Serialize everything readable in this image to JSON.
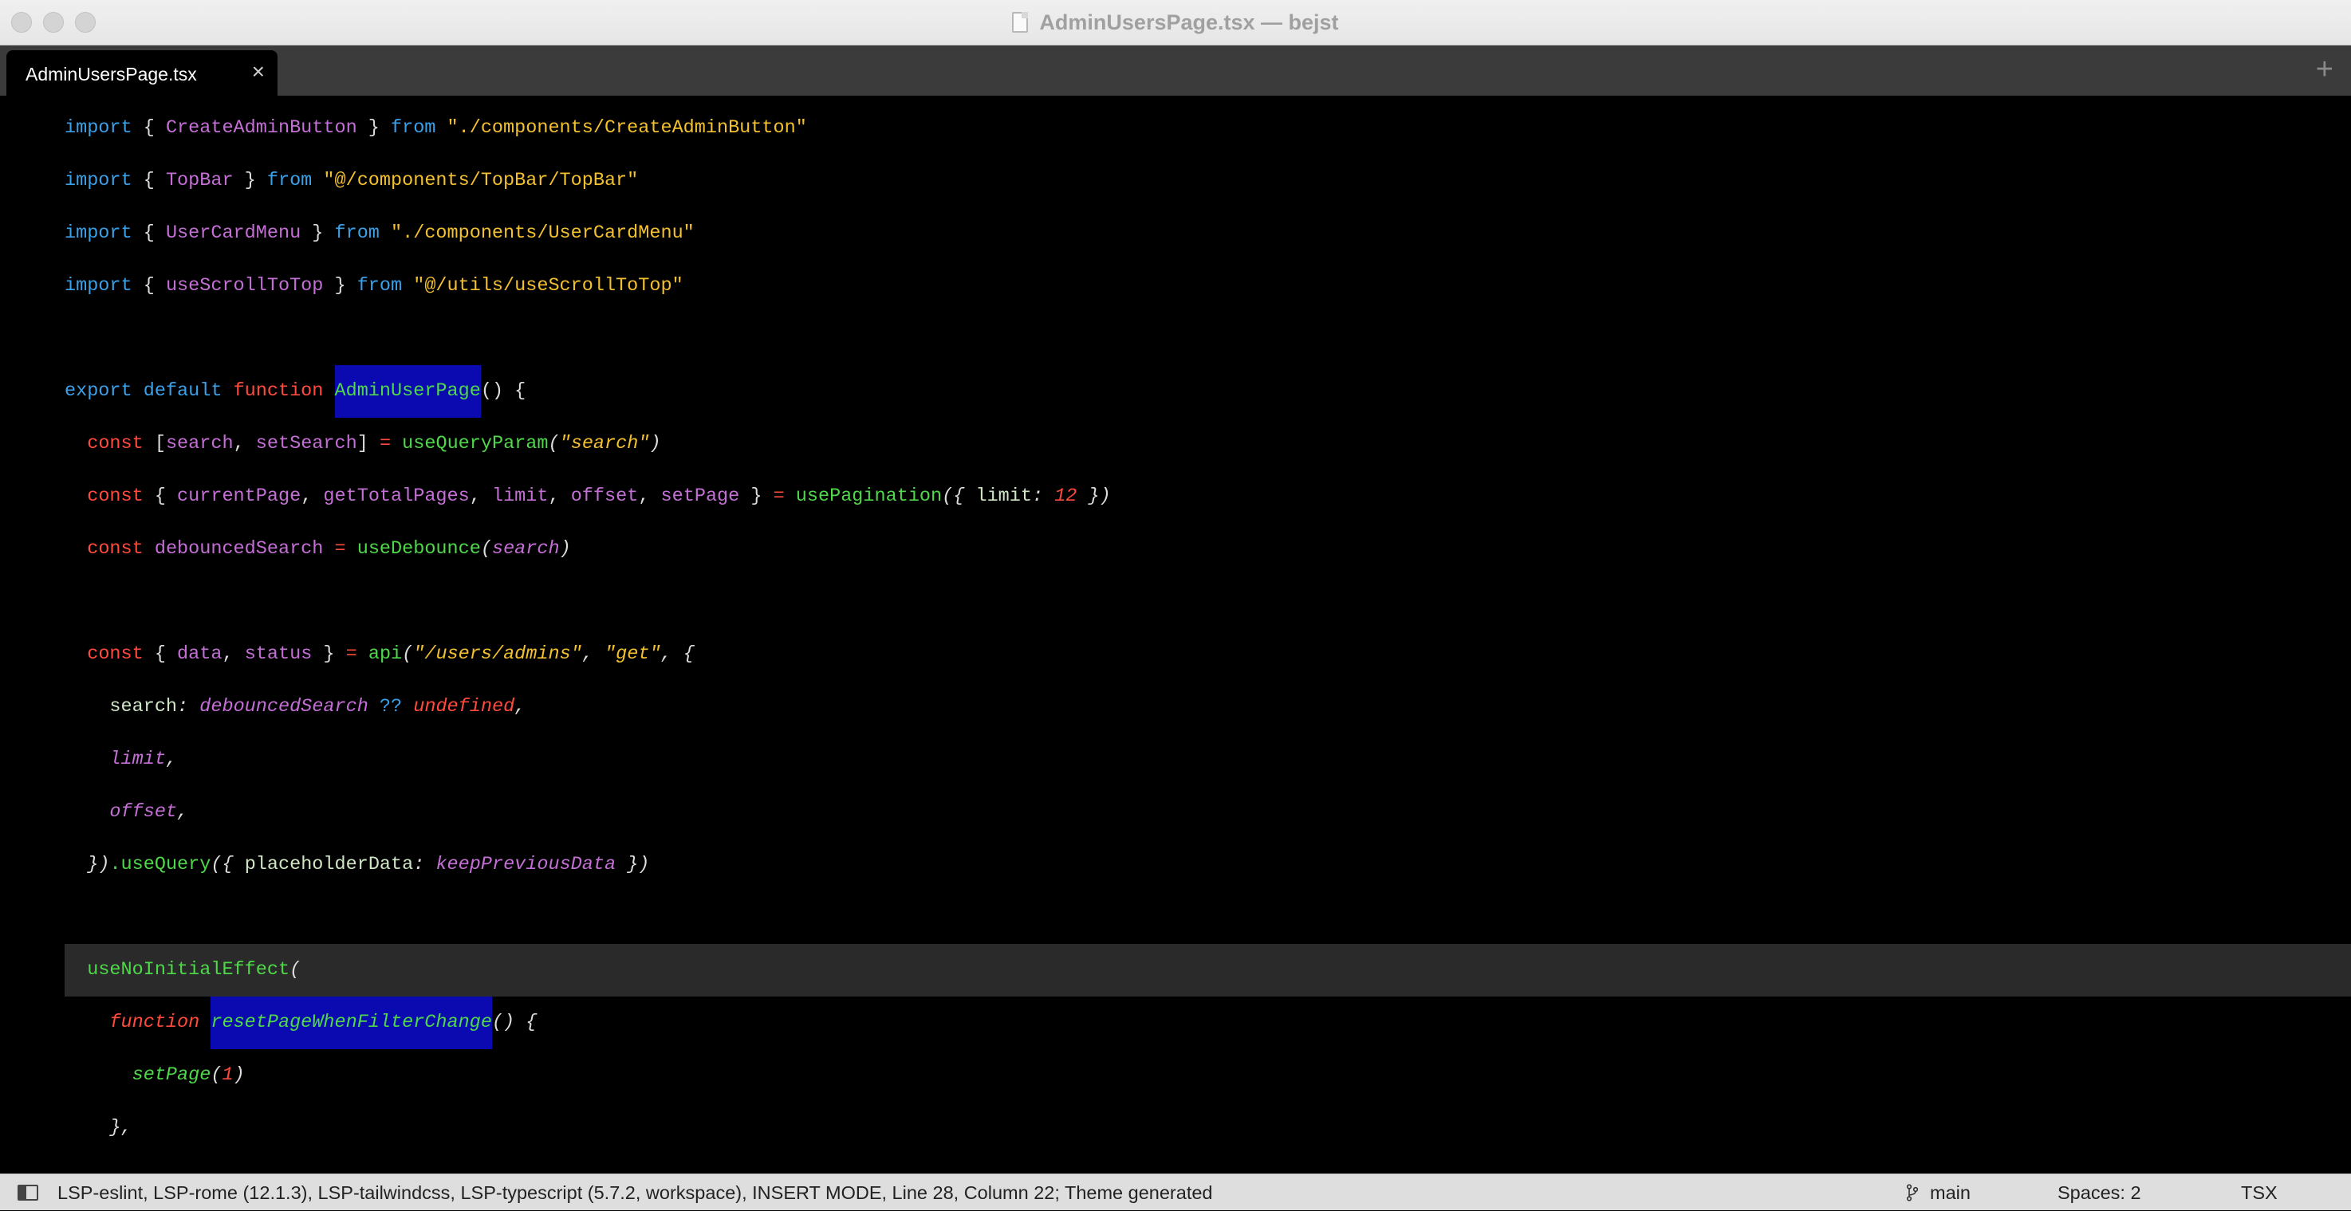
{
  "window": {
    "title": "AdminUsersPage.tsx — bejst"
  },
  "tabs": [
    {
      "label": "AdminUsersPage.tsx",
      "close_icon": "×"
    }
  ],
  "tabbar": {
    "add_icon": "+"
  },
  "editor": {
    "lines": {
      "l1": [
        "import",
        " { ",
        "CreateAdminButton",
        " } ",
        "from",
        " \"./components/CreateAdminButton\""
      ],
      "l2": [
        "import",
        " { ",
        "TopBar",
        " } ",
        "from",
        " \"@/components/TopBar/TopBar\""
      ],
      "l3": [
        "import",
        " { ",
        "UserCardMenu",
        " } ",
        "from",
        " \"./components/UserCardMenu\""
      ],
      "l4": [
        "import",
        " { ",
        "useScrollToTop",
        " } ",
        "from",
        " \"@/utils/useScrollToTop\""
      ],
      "l5": [
        "export",
        " ",
        "default",
        " ",
        "function",
        " ",
        "AdminUserPage",
        "() {"
      ],
      "l6": [
        "  ",
        "const",
        " [",
        "search",
        ", ",
        "setSearch",
        "] ",
        "=",
        " ",
        "useQueryParam",
        "(",
        "\"search\"",
        ")"
      ],
      "l7": [
        "  ",
        "const",
        " { ",
        "currentPage",
        ", ",
        "getTotalPages",
        ", ",
        "limit",
        ", ",
        "offset",
        ", ",
        "setPage",
        " } ",
        "=",
        " ",
        "usePagination",
        "({",
        " limit",
        ": ",
        "12",
        " })"
      ],
      "l8": [
        "  ",
        "const",
        " ",
        "debouncedSearch",
        " ",
        "=",
        " ",
        "useDebounce",
        "(",
        "search",
        ")"
      ],
      "l9": [
        "  ",
        "const",
        " { ",
        "data",
        ", ",
        "status",
        " } ",
        "=",
        " ",
        "api",
        "(",
        "\"/users/admins\"",
        ", ",
        "\"get\"",
        ", {"
      ],
      "l10": [
        "    ",
        "search",
        ": ",
        "debouncedSearch",
        " ",
        "??",
        " ",
        "undefined",
        ","
      ],
      "l11": [
        "    ",
        "limit",
        ","
      ],
      "l12": [
        "    ",
        "offset",
        ","
      ],
      "l13": [
        "  ",
        "})",
        ".",
        "useQuery",
        "({",
        " placeholderData",
        ": ",
        "keepPreviousData",
        " })"
      ],
      "l14": [
        "  ",
        "useNoInitialEffect",
        "("
      ],
      "l15": [
        "    ",
        "function",
        " ",
        "resetPageWhenFilterChange",
        "() {"
      ],
      "l16": [
        "      ",
        "setPage",
        "(",
        "1",
        ")"
      ],
      "l17": [
        "    ",
        "},"
      ]
    }
  },
  "statusbar": {
    "left": "LSP-eslint, LSP-rome (12.1.3), LSP-tailwindcss, LSP-typescript (5.7.2, workspace), INSERT MODE, Line 28, Column 22; Theme generated",
    "branch": "main",
    "spaces": "Spaces: 2",
    "syntax": "TSX"
  },
  "colors": {
    "keyword": "#3aa0e8",
    "keyword_red": "#ff4a3d",
    "identifier": "#c46fd6",
    "string": "#f3c12f",
    "function": "#4fd84a",
    "selection": "#0a0ab0",
    "current_line": "#2a2a2a"
  }
}
